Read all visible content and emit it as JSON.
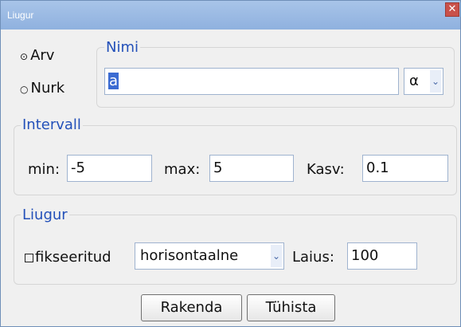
{
  "window": {
    "title": "Liugur",
    "close_glyph": "✕"
  },
  "nimi": {
    "radio_arv": {
      "label": "Arv",
      "selected": true
    },
    "radio_nurk": {
      "label": "Nurk",
      "selected": false
    },
    "legend": "Nimi",
    "name_value": "a",
    "symbol_value": "α"
  },
  "intervall": {
    "legend": "Intervall",
    "min_label": "min:",
    "min_value": "-5",
    "max_label": "max:",
    "max_value": "5",
    "kasv_label": "Kasv:",
    "kasv_value": "0.1"
  },
  "liugur": {
    "legend": "Liugur",
    "fixed_label": "fikseeritud",
    "orientation_value": "horisontaalne",
    "width_label": "Laius:",
    "width_value": "100"
  },
  "buttons": {
    "apply": "Rakenda",
    "cancel": "Tühista"
  },
  "colors": {
    "accent": "#2350b9",
    "selection": "#3b6bd2",
    "titlebar": "#8fb1df",
    "close": "#c9514a"
  },
  "icons": {
    "radio_on": "radio-selected-icon",
    "radio_off": "radio-unselected-icon",
    "dropdown": "chevron-down-icon",
    "checkbox": "checkbox-unchecked-icon"
  }
}
